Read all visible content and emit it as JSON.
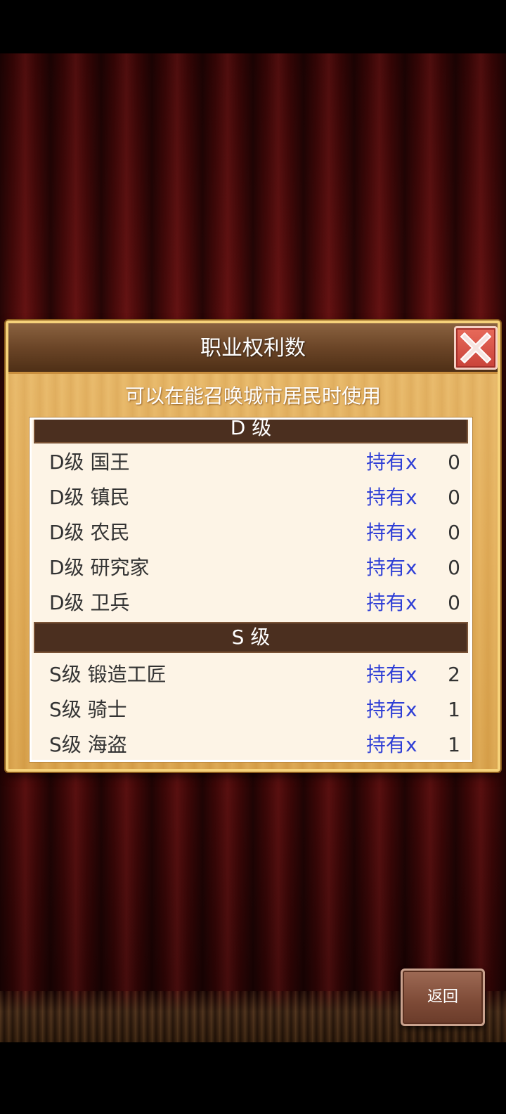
{
  "dialog": {
    "title": "职业权利数",
    "subtitle": "可以在能召唤城市居民时使用"
  },
  "sections": [
    {
      "header": "D 级",
      "rows": [
        {
          "name": "D级 国王",
          "held_label": "持有x",
          "count": "0"
        },
        {
          "name": "D级 镇民",
          "held_label": "持有x",
          "count": "0"
        },
        {
          "name": "D级 农民",
          "held_label": "持有x",
          "count": "0"
        },
        {
          "name": "D级 研究家",
          "held_label": "持有x",
          "count": "0"
        },
        {
          "name": "D级 卫兵",
          "held_label": "持有x",
          "count": "0"
        }
      ]
    },
    {
      "header": "S 级",
      "rows": [
        {
          "name": "S级 锻造工匠",
          "held_label": "持有x",
          "count": "2"
        },
        {
          "name": "S级 骑士",
          "held_label": "持有x",
          "count": "1"
        },
        {
          "name": "S级 海盗",
          "held_label": "持有x",
          "count": "1"
        }
      ]
    }
  ],
  "back_button": {
    "label": "返回"
  },
  "icons": {
    "close": "close-x-icon"
  },
  "colors": {
    "held_text": "#2f3fd6",
    "close_bg": "#d9524a",
    "section_header_bg": "#4b2f1f"
  }
}
